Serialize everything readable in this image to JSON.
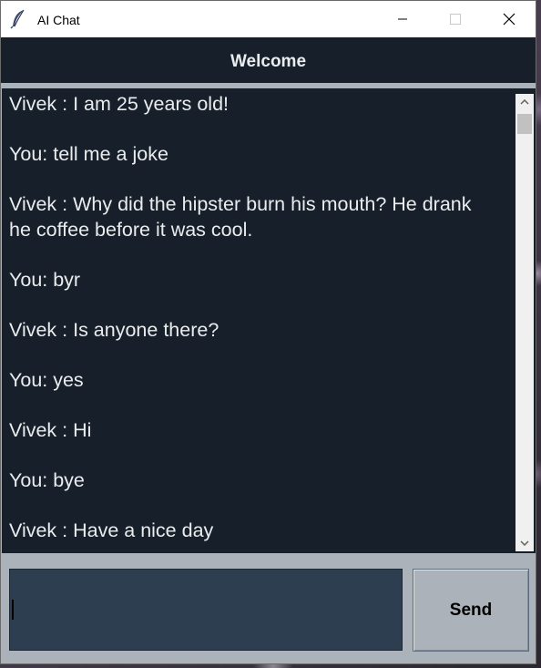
{
  "window": {
    "title": "AI Chat"
  },
  "header": {
    "title": "Welcome"
  },
  "chat": {
    "lines": [
      "Vivek : I am 25 years old!",
      "",
      "You: tell me a joke",
      "",
      "Vivek : Why did the hipster burn his mouth? He drank",
      "he coffee before it was cool.",
      "",
      "You: byr",
      "",
      "Vivek : Is anyone there?",
      "",
      "You: yes",
      "",
      "Vivek : Hi",
      "",
      "You: bye",
      "",
      "Vivek : Have a nice day"
    ]
  },
  "input": {
    "value": ""
  },
  "send": {
    "label": "Send"
  },
  "colors": {
    "header_bg": "#17202a",
    "text": "#eaecee",
    "input_bg": "#2c3e50",
    "window_bg": "#abb2b9"
  }
}
